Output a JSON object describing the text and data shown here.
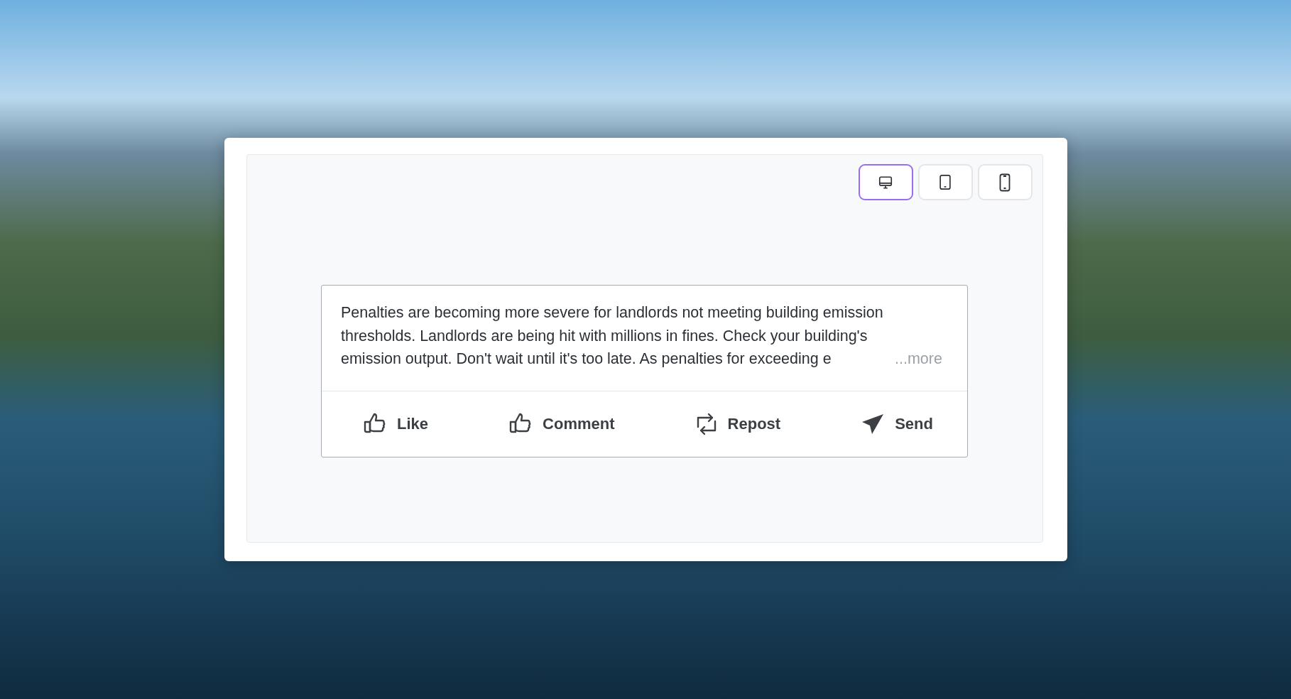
{
  "device_toggle": [
    {
      "kind": "desktop",
      "selected": true
    },
    {
      "kind": "tablet",
      "selected": false
    },
    {
      "kind": "phone",
      "selected": false
    }
  ],
  "post": {
    "text": "Penalties are becoming more severe for landlords not meeting building emission thresholds. Landlords are being hit with millions in fines. Check your building's emission output. Don't wait until it's too late. As penalties for exceeding e",
    "more_link": "...more"
  },
  "actions": [
    {
      "kind": "like",
      "label": "Like"
    },
    {
      "kind": "comment",
      "label": "Comment"
    },
    {
      "kind": "repost",
      "label": "Repost"
    },
    {
      "kind": "send",
      "label": "Send"
    }
  ]
}
